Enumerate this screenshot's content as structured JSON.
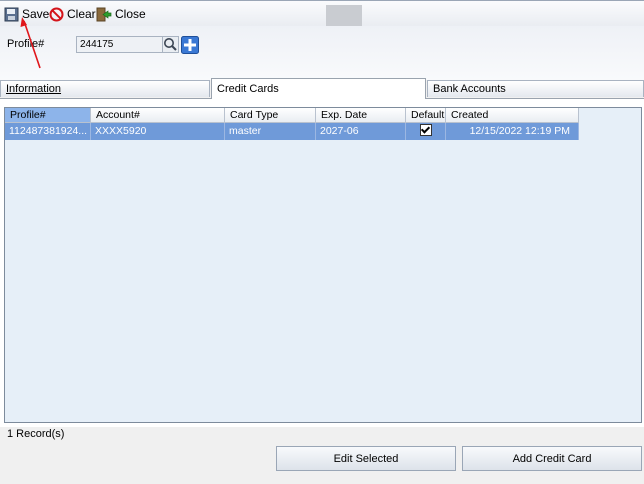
{
  "toolbar": {
    "save_label": "Save",
    "clear_label": "Clear",
    "close_label": "Close"
  },
  "profile": {
    "label": "Profile#",
    "value": "244175"
  },
  "tabs": [
    {
      "label": "Information"
    },
    {
      "label": "Credit Cards"
    },
    {
      "label": "Bank Accounts"
    }
  ],
  "grid": {
    "columns": [
      "Profile#",
      "Account#",
      "Card Type",
      "Exp. Date",
      "Default",
      "Created"
    ],
    "rows": [
      {
        "profile": "112487381924...",
        "account": "XXXX5920",
        "card_type": "master",
        "exp_date": "2027-06",
        "default": true,
        "created": "12/15/2022 12:19 PM"
      }
    ]
  },
  "status": {
    "records": "1 Record(s)"
  },
  "buttons": {
    "edit_selected": "Edit Selected",
    "add_credit_card": "Add Credit Card"
  },
  "colors": {
    "selection": "#6f9ad9",
    "grid_bg": "#e6eff8",
    "annotation_arrow": "#e0161b"
  }
}
